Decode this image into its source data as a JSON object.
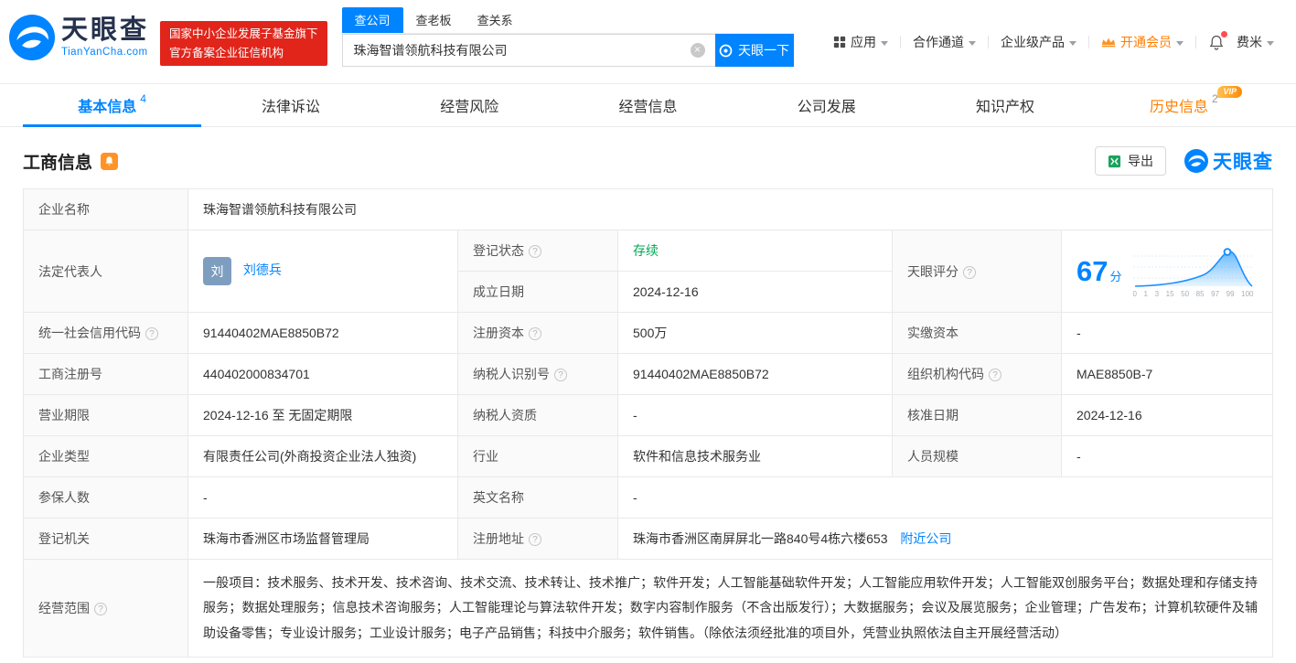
{
  "colors": {
    "accent_blue": "#0084FF",
    "status_green": "#00A854",
    "vip_orange": "#FF8000",
    "badge_red": "#E1251B"
  },
  "header": {
    "logo": {
      "title": "天眼查",
      "subtitle": "TianYanCha.com"
    },
    "badge": {
      "line1": "国家中小企业发展子基金旗下",
      "line2": "官方备案企业征信机构"
    },
    "search": {
      "tabs": [
        {
          "label": "查公司"
        },
        {
          "label": "查老板"
        },
        {
          "label": "查关系"
        }
      ],
      "value": "珠海智谱领航科技有限公司",
      "button_label": "天眼一下"
    },
    "menu": {
      "apps": "应用",
      "partner": "合作通道",
      "enterprise": "企业级产品",
      "vip": "开通会员",
      "user": "费米"
    }
  },
  "nav": {
    "tabs": [
      {
        "label": "基本信息",
        "count": "4"
      },
      {
        "label": "法律诉讼",
        "count": ""
      },
      {
        "label": "经营风险",
        "count": ""
      },
      {
        "label": "经营信息",
        "count": ""
      },
      {
        "label": "公司发展",
        "count": ""
      },
      {
        "label": "知识产权",
        "count": ""
      },
      {
        "label": "历史信息",
        "count": "2",
        "vip_tag": "VIP"
      }
    ]
  },
  "section": {
    "title": "工商信息",
    "export_label": "导出",
    "watermark": "天眼查"
  },
  "table": {
    "company_name": {
      "label": "企业名称",
      "value": "珠海智谱领航科技有限公司"
    },
    "legal_rep": {
      "label": "法定代表人",
      "avatar": "刘",
      "name": "刘德兵"
    },
    "reg_status": {
      "label": "登记状态",
      "value": "存续"
    },
    "establish_date": {
      "label": "成立日期",
      "value": "2024-12-16"
    },
    "score": {
      "label": "天眼评分",
      "value": "67",
      "unit": "分",
      "axis": [
        "0",
        "1",
        "3",
        "15",
        "50",
        "85",
        "97",
        "99",
        "100"
      ]
    },
    "credit_code": {
      "label": "统一社会信用代码",
      "value": "91440402MAE8850B72"
    },
    "reg_capital": {
      "label": "注册资本",
      "value": "500万"
    },
    "paid_capital": {
      "label": "实缴资本",
      "value": "-"
    },
    "reg_number": {
      "label": "工商注册号",
      "value": "440402000834701"
    },
    "taxpayer_id": {
      "label": "纳税人识别号",
      "value": "91440402MAE8850B72"
    },
    "org_code": {
      "label": "组织机构代码",
      "value": "MAE8850B-7"
    },
    "business_term": {
      "label": "营业期限",
      "value": "2024-12-16 至 无固定期限"
    },
    "taxpayer_quality": {
      "label": "纳税人资质",
      "value": "-"
    },
    "approval_date": {
      "label": "核准日期",
      "value": "2024-12-16"
    },
    "company_type": {
      "label": "企业类型",
      "value": "有限责任公司(外商投资企业法人独资)"
    },
    "industry": {
      "label": "行业",
      "value": "软件和信息技术服务业"
    },
    "staff_size": {
      "label": "人员规模",
      "value": "-"
    },
    "insured_count": {
      "label": "参保人数",
      "value": "-"
    },
    "english_name": {
      "label": "英文名称",
      "value": "-"
    },
    "registry": {
      "label": "登记机关",
      "value": "珠海市香洲区市场监督管理局"
    },
    "address": {
      "label": "注册地址",
      "value": "珠海市香洲区南屏屏北一路840号4栋六楼653",
      "nearby_link": "附近公司"
    },
    "business_scope": {
      "label": "经营范围",
      "value": "一般项目：技术服务、技术开发、技术咨询、技术交流、技术转让、技术推广；软件开发；人工智能基础软件开发；人工智能应用软件开发；人工智能双创服务平台；数据处理和存储支持服务；数据处理服务；信息技术咨询服务；人工智能理论与算法软件开发；数字内容制作服务（不含出版发行）；大数据服务；会议及展览服务；企业管理；广告发布；计算机软硬件及辅助设备零售；专业设计服务；工业设计服务；电子产品销售；科技中介服务；软件销售。（除依法须经批准的项目外，凭营业执照依法自主开展经营活动）"
    }
  },
  "icons": {
    "help": "?",
    "clear": "×"
  }
}
